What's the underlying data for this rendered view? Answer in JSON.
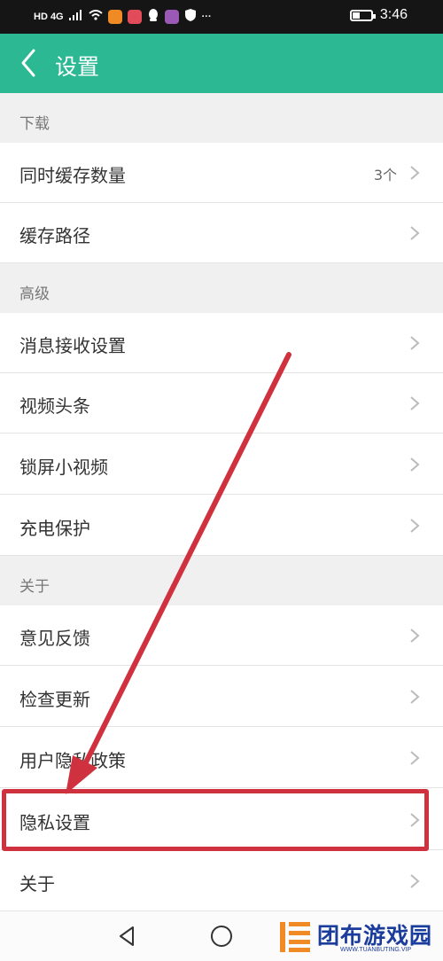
{
  "status_bar": {
    "network": "HD 4G",
    "time": "3:46"
  },
  "header": {
    "title": "设置",
    "back_icon": "chevron-left-icon"
  },
  "sections": [
    {
      "title": "下载",
      "items": [
        {
          "label": "同时缓存数量",
          "value": "3个"
        },
        {
          "label": "缓存路径",
          "value": ""
        }
      ]
    },
    {
      "title": "高级",
      "items": [
        {
          "label": "消息接收设置",
          "value": ""
        },
        {
          "label": "视频头条",
          "value": ""
        },
        {
          "label": "锁屏小视频",
          "value": ""
        },
        {
          "label": "充电保护",
          "value": ""
        }
      ]
    },
    {
      "title": "关于",
      "items": [
        {
          "label": "意见反馈",
          "value": ""
        },
        {
          "label": "检查更新",
          "value": ""
        },
        {
          "label": "用户隐私政策",
          "value": ""
        },
        {
          "label": "隐私设置",
          "value": ""
        },
        {
          "label": "关于",
          "value": ""
        }
      ]
    }
  ],
  "annotation": {
    "highlighted_item": "隐私设置",
    "color": "#d0313f"
  },
  "watermark": {
    "text": "团布游戏园",
    "subtext": "WWW.TUANBUTING.VIP"
  },
  "colors": {
    "accent": "#2bb892",
    "section_bg": "#f0f0f0"
  }
}
